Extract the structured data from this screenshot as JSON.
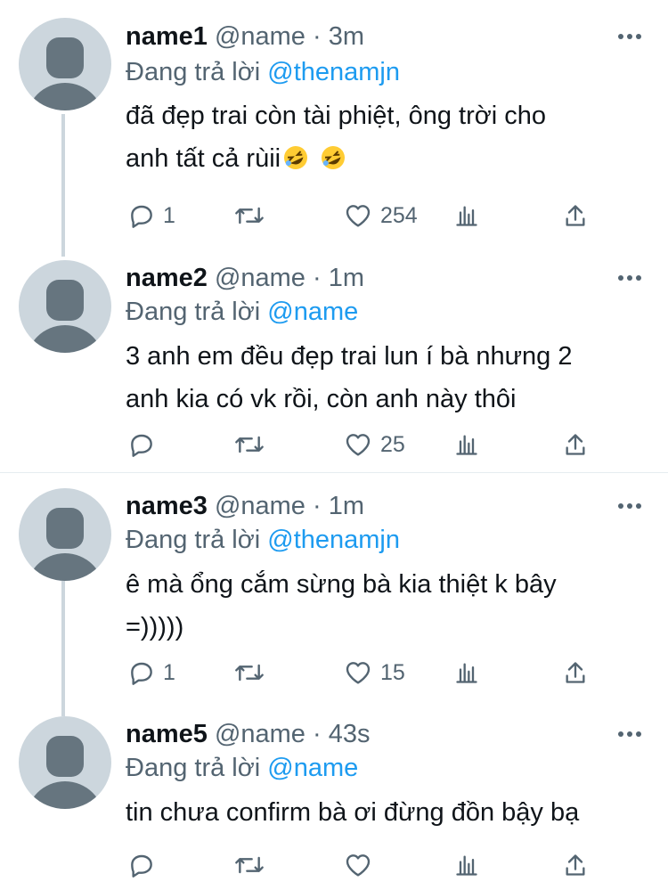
{
  "tweets": [
    {
      "name": "name1",
      "handle": "@name",
      "dot": "·",
      "time": "3m",
      "reply_prefix": "Đang trả lời",
      "reply_to": "@thenamjn",
      "text_line1": "đã đẹp trai còn tài phiệt, ông trời cho",
      "text_line2": "anh tất cả rùii",
      "emoji": "rolling-on-floor-laughing",
      "replies": "1",
      "retweets": "",
      "likes": "254"
    },
    {
      "name": "name2",
      "handle": "@name",
      "dot": "·",
      "time": "1m",
      "reply_prefix": "Đang trả lời",
      "reply_to": "@name",
      "text_line1": "3 anh em đều đẹp trai lun í bà nhưng 2",
      "text_line2": "anh kia có vk rồi, còn anh này thôi",
      "replies": "",
      "retweets": "",
      "likes": "25"
    },
    {
      "name": "name3",
      "handle": "@name",
      "dot": "·",
      "time": "1m",
      "reply_prefix": "Đang trả lời",
      "reply_to": "@thenamjn",
      "text_line1": "ê mà ổng cắm sừng bà kia thiệt k bây",
      "text_line2": "=)))))",
      "replies": "1",
      "retweets": "",
      "likes": "15"
    },
    {
      "name": "name5",
      "handle": "@name",
      "dot": "·",
      "time": "43s",
      "reply_prefix": "Đang trả lời",
      "reply_to": "@name",
      "text_line1": "tin chưa confirm bà ơi đừng đồn bậy bạ",
      "text_line2": "",
      "replies": "",
      "retweets": "",
      "likes": ""
    }
  ],
  "colors": {
    "accent": "#1d9bf0",
    "secondary_text": "#536471",
    "primary_text": "#0f1419",
    "avatar_bg": "#ccd6dd",
    "thread_line": "#ccd6dd"
  },
  "icons": [
    "reply-icon",
    "retweet-icon",
    "like-icon",
    "analytics-icon",
    "share-icon",
    "more-icon"
  ]
}
